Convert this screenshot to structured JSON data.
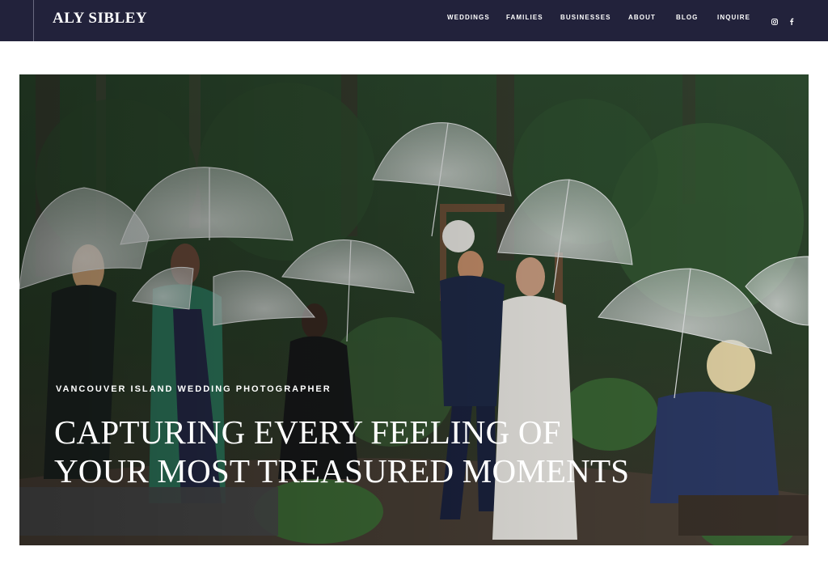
{
  "header": {
    "logo": "ALY SIBLEY",
    "nav": [
      "WEDDINGS",
      "FAMILIES",
      "BUSINESSES",
      "ABOUT",
      "BLOG",
      "INQUIRE"
    ],
    "social": [
      "instagram-icon",
      "facebook-icon"
    ],
    "background": "#22223b"
  },
  "hero": {
    "eyebrow": "VANCOUVER ISLAND WEDDING PHOTOGRAPHER",
    "heading_line1": "CAPTURING EVERY FEELING OF",
    "heading_line2": "YOUR MOST TREASURED MOMENTS",
    "image": "wedding-recessional-with-clear-umbrellas-in-forest"
  }
}
